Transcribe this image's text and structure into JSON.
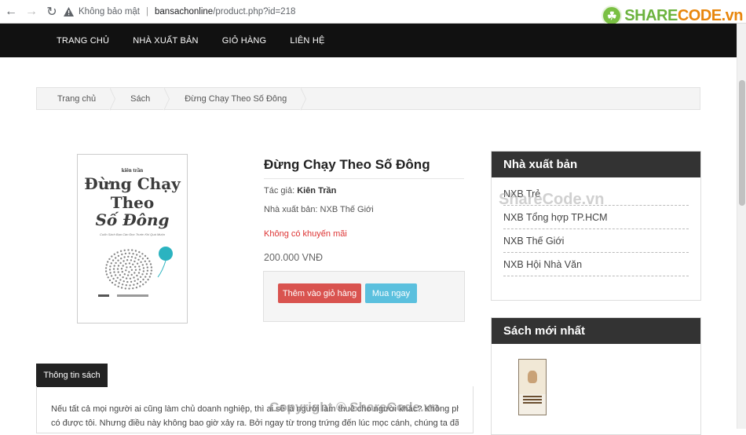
{
  "browser": {
    "security_label": "Không bảo mật",
    "url_host": "bansachonline",
    "url_path": "/product.php?id=218"
  },
  "watermark_logo": {
    "part_a": "SHARE",
    "part_b": "CODE.vn"
  },
  "nav": {
    "items": [
      "TRANG CHỦ",
      "NHÀ XUẤT BẢN",
      "GIỎ HÀNG",
      "LIÊN HỆ"
    ]
  },
  "breadcrumb": [
    "Trang chủ",
    "Sách",
    "Đừng Chạy Theo Số Đông"
  ],
  "cover": {
    "author": "kiên trần",
    "title_line1": "Đừng Chạy",
    "title_line2": "Theo",
    "title_line3": "Số Đông",
    "subtitle": "Cuốn Sách Bạn Cần Đọc Trước Khi Quá Muộn"
  },
  "product": {
    "title": "Đừng Chạy Theo Số Đông",
    "author_label": "Tác giả: ",
    "author": "Kiên Trần",
    "publisher_label": "Nhà xuất bản: NXB Thế Giới",
    "promo": "Không có khuyến mãi",
    "price": "200.000 VNĐ",
    "add_to_cart": "Thêm vào giỏ hàng",
    "buy_now": "Mua ngay"
  },
  "publishers": {
    "heading": "Nhà xuất bản",
    "items": [
      "NXB Trẻ",
      "NXB Tổng hợp TP.HCM",
      "NXB Thế Giới",
      "NXB Hội Nhà Văn"
    ]
  },
  "newest": {
    "heading": "Sách mới nhất"
  },
  "info_tab": {
    "label": "Thông tin sách",
    "text_line1": "Nếu tất cả mọi người ai cũng làm chủ doanh nghiệp, thì ai sẽ là người làm thuê cho người khác? Không phải ai",
    "text_line2": "có được tôi. Nhưng điều này không bao giờ xảy ra. Bởi ngay từ trong trứng đến lúc mọc cánh, chúng ta đã"
  },
  "watermarks": {
    "center": "ShareCode.vn",
    "bottom": "Copyright © ShareCode.vn"
  }
}
